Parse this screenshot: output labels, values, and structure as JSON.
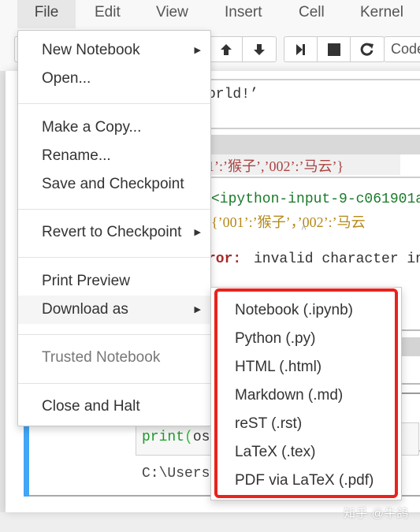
{
  "menubar": {
    "items": [
      {
        "label": "File",
        "active": true
      },
      {
        "label": "Edit"
      },
      {
        "label": "View"
      },
      {
        "label": "Insert"
      },
      {
        "label": "Cell"
      },
      {
        "label": "Kernel"
      }
    ]
  },
  "toolbar": {
    "buttons": [
      {
        "icon": "arrow-up-icon",
        "glyph": "↑"
      },
      {
        "icon": "arrow-down-icon",
        "glyph": "↓"
      },
      {
        "icon": "run-next-icon"
      },
      {
        "icon": "stop-icon"
      },
      {
        "icon": "restart-icon"
      }
    ],
    "cell_type": "Code"
  },
  "notebook": {
    "hello_fragment": "orld!’",
    "dict_fragment": "1’:’猴子’,’002’:’马云’}",
    "trace_line1": "<ipython-input-9-c061901a",
    "trace_line2": "{’001’:’猴子’，’002’:’马云",
    "caret": "^",
    "error_label": "ror:",
    "error_message": "invalid character in",
    "print_code_kw": "print",
    "print_code_paren": "(",
    "print_code_rest": "os.",
    "output_path": "C:\\Users\\"
  },
  "file_menu": {
    "items": [
      {
        "label": "New Notebook",
        "submenu": true
      },
      {
        "label": "Open..."
      },
      {
        "label": "Make a Copy..."
      },
      {
        "label": "Rename..."
      },
      {
        "label": "Save and Checkpoint"
      },
      {
        "label": "Revert to Checkpoint",
        "submenu": true
      },
      {
        "label": "Print Preview"
      },
      {
        "label": "Download as",
        "submenu": true,
        "hovered": true
      },
      {
        "label": "Trusted Notebook",
        "disabled": true
      },
      {
        "label": "Close and Halt"
      }
    ],
    "submenu_caret": "▶"
  },
  "download_menu": {
    "items": [
      {
        "label": "Notebook (.ipynb)"
      },
      {
        "label": "Python (.py)"
      },
      {
        "label": "HTML (.html)"
      },
      {
        "label": "Markdown (.md)"
      },
      {
        "label": "reST (.rst)"
      },
      {
        "label": "LaTeX (.tex)"
      },
      {
        "label": "PDF via LaTeX (.pdf)"
      }
    ],
    "highlight_color": "#e8231c"
  },
  "watermark": "知乎 @牛鸽",
  "colors": {
    "selected_cell_bar": "#42a5f5",
    "error_red": "#a52a2a",
    "string_red": "#a94442",
    "trace_green": "#1a7a2a"
  }
}
